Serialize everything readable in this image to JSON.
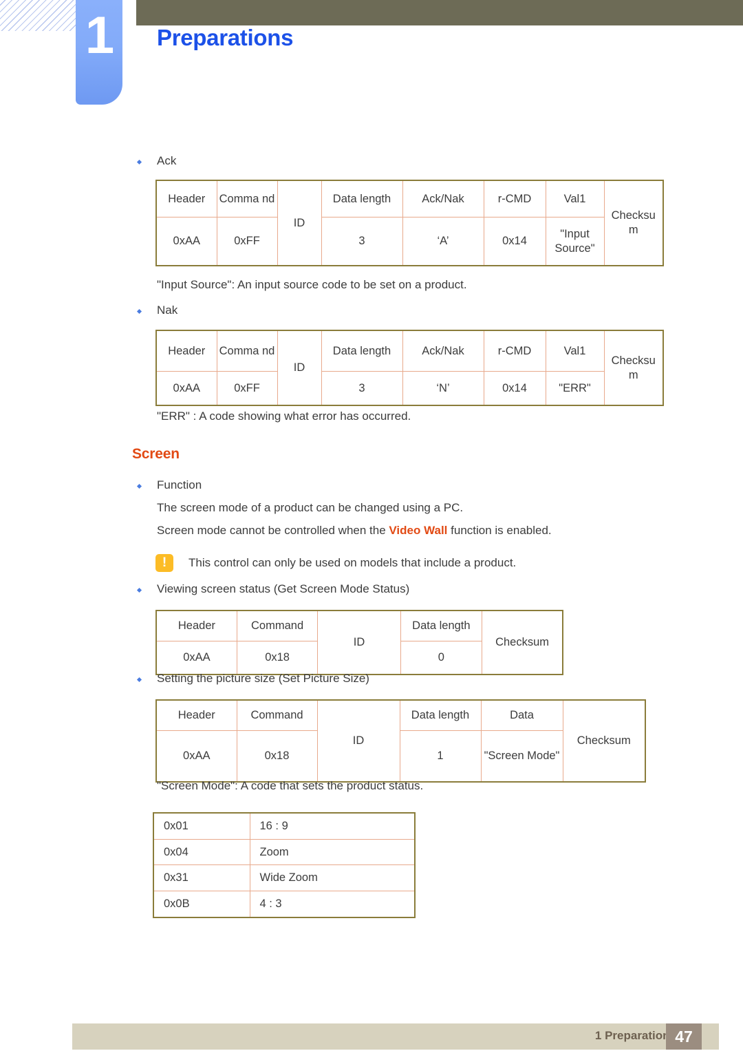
{
  "header": {
    "chapter_number": "1",
    "chapter_title": "Preparations",
    "olive_color": "#6d6b56",
    "tab_color": "#83abf9",
    "title_color": "#1c51e8"
  },
  "sections": {
    "ack_bullet": "Ack",
    "input_source_note": "\"Input Source\": An input source code to be set on a product.",
    "nak_bullet": "Nak",
    "err_note": "\"ERR\" : A code showing what error has occurred.",
    "screen_heading": "Screen",
    "function_bullet": "Function",
    "function_line1": "The screen mode of a product can be changed using a PC.",
    "function_line2_pre": "Screen mode cannot be controlled when the ",
    "function_line2_hl": "Video Wall",
    "function_line2_post": " function is enabled.",
    "caution_text": "This control can only be used on models that include a product.",
    "caution_icon": "warning-exclamation-icon",
    "get_screen_mode_bullet": "Viewing screen status (Get Screen Mode Status)",
    "set_picture_size_bullet": "Setting the picture size (Set Picture Size)",
    "screen_mode_note": "\"Screen Mode\": A code that sets the product status."
  },
  "tables": {
    "ack": {
      "caption": "Ack",
      "header_row": [
        "Header",
        "Comma nd",
        "ID",
        "Data length",
        "Ack/Nak",
        "r-CMD",
        "Val1",
        "Checksu m"
      ],
      "value_row": [
        "0xAA",
        "0xFF",
        "3",
        "‘A’",
        "0x14",
        "\"Input Source\""
      ]
    },
    "nak": {
      "caption": "Nak",
      "header_row": [
        "Header",
        "Comma nd",
        "ID",
        "Data length",
        "Ack/Nak",
        "r-CMD",
        "Val1",
        "Checksu m"
      ],
      "value_row": [
        "0xAA",
        "0xFF",
        "3",
        "‘N’",
        "0x14",
        "\"ERR\""
      ]
    },
    "get_screen_mode": {
      "header_row": [
        "Header",
        "Command",
        "ID",
        "Data length",
        "Checksum"
      ],
      "value_row": [
        "0xAA",
        "0x18",
        "0"
      ]
    },
    "set_picture_size": {
      "header_row": [
        "Header",
        "Command",
        "ID",
        "Data length",
        "Data",
        "Checksum"
      ],
      "value_row": [
        "0xAA",
        "0x18",
        "1",
        "\"Screen Mode\""
      ]
    },
    "screen_mode_codes": {
      "rows": [
        {
          "code": "0x01",
          "label": "16 : 9"
        },
        {
          "code": "0x04",
          "label": "Zoom"
        },
        {
          "code": "0x31",
          "label": "Wide Zoom"
        },
        {
          "code": "0x0B",
          "label": "4 : 3"
        }
      ]
    }
  },
  "footer": {
    "label": "1 Preparations",
    "page_number": "47",
    "bar_color": "#d7d2be",
    "page_box_color": "#9b8d80"
  }
}
